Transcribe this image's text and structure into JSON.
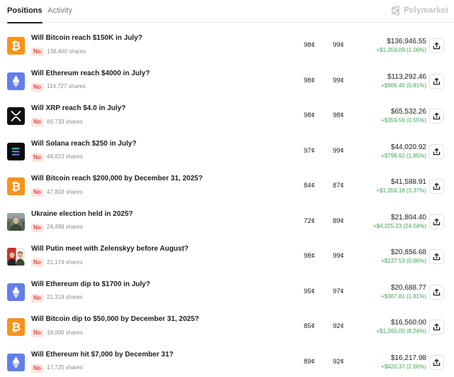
{
  "tabs": {
    "positions": "Positions",
    "activity": "Activity"
  },
  "brand": {
    "name": "Polymarket",
    "icon": "polymarket-logo-icon"
  },
  "colors": {
    "bitcoin": "#f7931a",
    "ethereum": "#627eea",
    "xrp": "#111111",
    "solana": "#0b0b0b",
    "no_badge_bg": "#fde6e4",
    "no_badge_text": "#e5483b",
    "gain": "#3aa655"
  },
  "positions": [
    {
      "icon": "bitcoin-icon",
      "title": "Will Bitcoin reach $150K in July?",
      "outcome": "No",
      "shares": "138,400 shares",
      "avg": "98¢",
      "current": "99¢",
      "value": "$136,946.55",
      "pnl": "+$1,359.09 (1.00%)"
    },
    {
      "icon": "ethereum-icon",
      "title": "Will Ethereum reach $4000 in July?",
      "outcome": "No",
      "shares": "114,727 shares",
      "avg": "98¢",
      "current": "99¢",
      "value": "$113,292.46",
      "pnl": "+$906.45 (0.81%)"
    },
    {
      "icon": "xrp-icon",
      "title": "Will XRP reach $4.0 in July?",
      "outcome": "No",
      "shares": "66,733 shares",
      "avg": "98¢",
      "current": "98¢",
      "value": "$65,532.26",
      "pnl": "+$359.56 (0.55%)"
    },
    {
      "icon": "solana-icon",
      "title": "Will Solana reach $250 in July?",
      "outcome": "No",
      "shares": "44,623 shares",
      "avg": "97¢",
      "current": "99¢",
      "value": "$44,020.92",
      "pnl": "+$798.62 (1.85%)"
    },
    {
      "icon": "bitcoin-icon",
      "title": "Will Bitcoin reach $200,000 by December 31, 2025?",
      "outcome": "No",
      "shares": "47,803 shares",
      "avg": "84¢",
      "current": "87¢",
      "value": "$41,588.91",
      "pnl": "+$1,356.18 (3.37%)"
    },
    {
      "icon": "ukraine-photo-icon",
      "title": "Ukraine election held in 2025?",
      "outcome": "No",
      "shares": "24,499 shares",
      "avg": "72¢",
      "current": "89¢",
      "value": "$21,804.40",
      "pnl": "+$4,225.23 (24.04%)"
    },
    {
      "icon": "putin-zelenskyy-photo-icon",
      "title": "Will Putin meet with Zelenskyy before August?",
      "outcome": "No",
      "shares": "21,174 shares",
      "avg": "98¢",
      "current": "99¢",
      "value": "$20,856.68",
      "pnl": "+$137.53 (0.66%)"
    },
    {
      "icon": "ethereum-icon",
      "title": "Will Ethereum dip to $1700 in July?",
      "outcome": "No",
      "shares": "21,318 shares",
      "avg": "95¢",
      "current": "97¢",
      "value": "$20,688.77",
      "pnl": "+$367.81 (1.81%)"
    },
    {
      "icon": "bitcoin-icon",
      "title": "Will Bitcoin dip to $50,000 by December 31, 2025?",
      "outcome": "No",
      "shares": "18,000 shares",
      "avg": "85¢",
      "current": "92¢",
      "value": "$16,560.00",
      "pnl": "+$1,260.00 (8.24%)"
    },
    {
      "icon": "ethereum-icon",
      "title": "Will Ethereum hit $7,000 by December 31?",
      "outcome": "No",
      "shares": "17,725 shares",
      "avg": "89¢",
      "current": "92¢",
      "value": "$16,217.98",
      "pnl": "+$420.37 (2.66%)"
    }
  ]
}
